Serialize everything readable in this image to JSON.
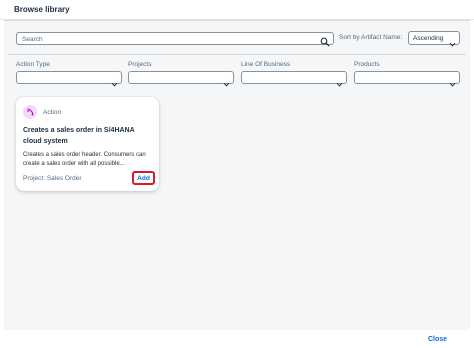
{
  "dialog": {
    "title": "Browse library"
  },
  "search": {
    "placeholder": "Search"
  },
  "sort": {
    "label": "Sort by Artifact Name:",
    "value": "Ascending"
  },
  "filters": [
    {
      "label": "Action Type"
    },
    {
      "label": "Projects"
    },
    {
      "label": "Line Of Business"
    },
    {
      "label": "Products"
    }
  ],
  "cards": [
    {
      "type": "Action",
      "icon": "action-icon",
      "title": "Creates a sales order in S/4HANA cloud system",
      "description": "Creates a sales order header. Consumers can create a sales order with all possible...",
      "project": "Project: Sales Order",
      "add_label": "Add"
    }
  ],
  "footer": {
    "close_label": "Close"
  },
  "colors": {
    "accent": "#0a6ed1",
    "highlight": "#d21f24",
    "icon_bg": "#f3d9f7",
    "icon_fg": "#a100c2"
  }
}
